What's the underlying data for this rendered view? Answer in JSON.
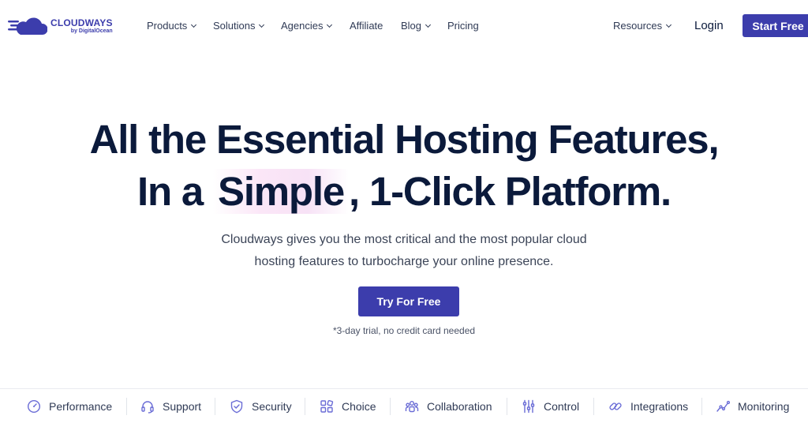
{
  "logo": {
    "main": "CLOUDWAYS",
    "sub": "by DigitalOcean",
    "icon": "cloud-logo-icon"
  },
  "nav": {
    "items": [
      {
        "label": "Products",
        "dropdown": true
      },
      {
        "label": "Solutions",
        "dropdown": true
      },
      {
        "label": "Agencies",
        "dropdown": true
      },
      {
        "label": "Affiliate",
        "dropdown": false
      },
      {
        "label": "Blog",
        "dropdown": true
      },
      {
        "label": "Pricing",
        "dropdown": false
      }
    ],
    "resources": "Resources",
    "login": "Login",
    "start": "Start Free"
  },
  "hero": {
    "line1": "All the Essential Hosting Features,",
    "line2_pre": "In a ",
    "line2_highlight": "Simple",
    "line2_post": ", 1-Click Platform.",
    "sub1": "Cloudways gives you the most critical and the most popular cloud",
    "sub2": "hosting features to turbocharge your online presence.",
    "cta": "Try For Free",
    "note": "*3-day trial, no credit card needed"
  },
  "tabs": [
    {
      "label": "Performance",
      "icon": "speedometer-icon"
    },
    {
      "label": "Support",
      "icon": "headset-icon"
    },
    {
      "label": "Security",
      "icon": "shield-icon"
    },
    {
      "label": "Choice",
      "icon": "grid-icon"
    },
    {
      "label": "Collaboration",
      "icon": "team-icon"
    },
    {
      "label": "Control",
      "icon": "sliders-icon"
    },
    {
      "label": "Integrations",
      "icon": "link-icon"
    },
    {
      "label": "Monitoring",
      "icon": "chart-line-icon"
    }
  ],
  "colors": {
    "brand": "#3c3dac",
    "heading": "#0b1a3b",
    "icon": "#6a6cd6"
  }
}
